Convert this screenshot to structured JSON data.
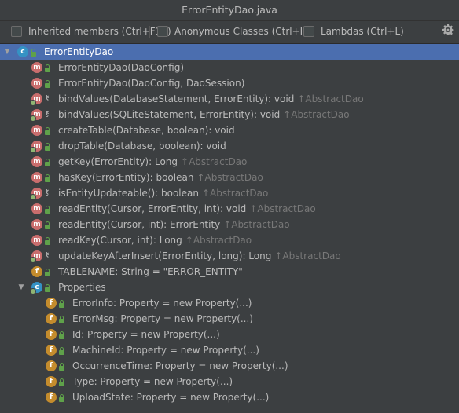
{
  "window": {
    "title": "ErrorEntityDao.java"
  },
  "toolbar": {
    "inherited_label": "Inherited members (Ctrl+F12)",
    "anonymous_label": "Anonymous Classes (Ctrl+I)",
    "lambdas_label": "Lambdas (Ctrl+L)",
    "settings_icon": "gear-icon"
  },
  "tree": {
    "root": {
      "label": "ErrorEntityDao",
      "icon": "class-icon"
    },
    "members": [
      {
        "label": "ErrorEntityDao(DaoConfig)",
        "inherited": "",
        "icon": "method-icon"
      },
      {
        "label": "ErrorEntityDao(DaoConfig, DaoSession)",
        "inherited": "",
        "icon": "method-icon"
      },
      {
        "label": "bindValues(DatabaseStatement, ErrorEntity): void",
        "inherited": "↑AbstractDao",
        "icon": "method-icon"
      },
      {
        "label": "bindValues(SQLiteStatement, ErrorEntity): void",
        "inherited": "↑AbstractDao",
        "icon": "method-icon"
      },
      {
        "label": "createTable(Database, boolean): void",
        "inherited": "",
        "icon": "method-icon"
      },
      {
        "label": "dropTable(Database, boolean): void",
        "inherited": "",
        "icon": "method-icon"
      },
      {
        "label": "getKey(ErrorEntity): Long",
        "inherited": "↑AbstractDao",
        "icon": "method-icon"
      },
      {
        "label": "hasKey(ErrorEntity): boolean",
        "inherited": "↑AbstractDao",
        "icon": "method-icon"
      },
      {
        "label": "isEntityUpdateable(): boolean",
        "inherited": "↑AbstractDao",
        "icon": "method-icon"
      },
      {
        "label": "readEntity(Cursor, ErrorEntity, int): void",
        "inherited": "↑AbstractDao",
        "icon": "method-icon"
      },
      {
        "label": "readEntity(Cursor, int): ErrorEntity",
        "inherited": "↑AbstractDao",
        "icon": "method-icon"
      },
      {
        "label": "readKey(Cursor, int): Long",
        "inherited": "↑AbstractDao",
        "icon": "method-icon"
      },
      {
        "label": "updateKeyAfterInsert(ErrorEntity, long): Long",
        "inherited": "↑AbstractDao",
        "icon": "method-icon"
      },
      {
        "label": "TABLENAME: String = \"ERROR_ENTITY\"",
        "inherited": "",
        "icon": "field-icon"
      }
    ],
    "properties": {
      "label": "Properties",
      "icon": "class-icon",
      "items": [
        {
          "label": "ErrorInfo: Property = new Property(...)"
        },
        {
          "label": "ErrorMsg: Property = new Property(...)"
        },
        {
          "label": "Id: Property = new Property(...)"
        },
        {
          "label": "MachineId: Property = new Property(...)"
        },
        {
          "label": "OccurrenceTime: Property = new Property(...)"
        },
        {
          "label": "Type: Property = new Property(...)"
        },
        {
          "label": "UploadState: Property = new Property(...)"
        }
      ]
    }
  },
  "colors": {
    "selection": "#4b6eaf",
    "method": "#c96d6d",
    "field": "#c48c2d",
    "class": "#3592c4"
  }
}
